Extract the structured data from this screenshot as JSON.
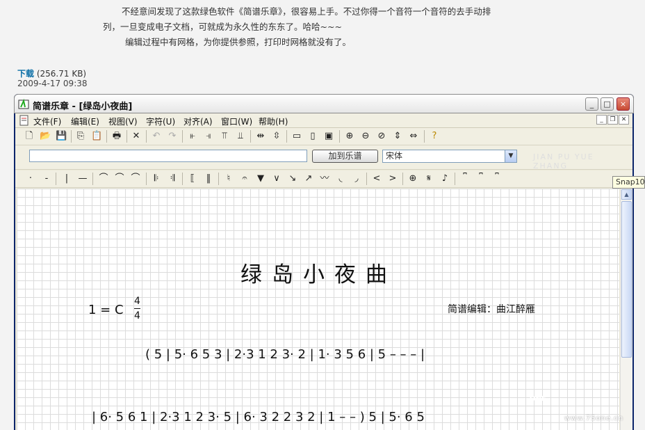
{
  "article": {
    "line1": "不经意间发现了这款绿色软件《简谱乐章》，很容易上手。不过你得一个音符一个音符的去手动排",
    "line2": "列，一旦变成电子文档，可就成为永久性的东东了。哈哈~~~",
    "line3": "编辑过程中有网格，为你提供参照，打印时网格就没有了。",
    "download_label": "下载",
    "file_size": "(256.71 KB)",
    "date": "2009-4-17 09:38"
  },
  "window": {
    "title": "简谱乐章 - [绿岛小夜曲]",
    "minimize": "_",
    "maximize": "□",
    "close": "×"
  },
  "menu": {
    "items": [
      "文件(F)",
      "编辑(E)",
      "视图(V)",
      "字符(U)",
      "对齐(A)",
      "窗口(W)",
      "帮助(H)"
    ]
  },
  "input_bar": {
    "add_button": "加到乐谱",
    "font_value": "宋体",
    "ghost_text": "JIAN PU YUE ZHANG"
  },
  "score": {
    "title": "绿岛小夜曲",
    "key": "1 = C",
    "time_top": "4",
    "time_bottom": "4",
    "editor": "简谱编辑：曲江醉雁",
    "line1": "(  5 | 5· 6  5  3  | 2·3  1 2  3· 2 | 1·  3  5  6  | 5  –  –  –  |",
    "line2": "| 6·  5   6   1  | 2·3  1 2  3· 5 | 6·  3  2  2 3 2 | 1  –  – ) 5 | 5· 6  5"
  },
  "tooltip": "Snap10",
  "watermark": {
    "logo": "ONE",
    "url": "www.75one.cn"
  }
}
